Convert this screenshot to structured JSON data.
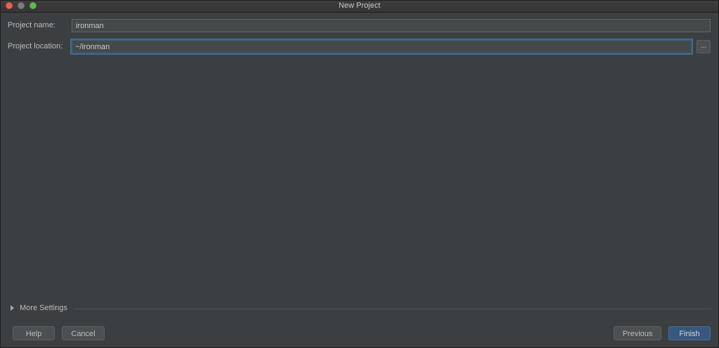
{
  "window": {
    "title": "New Project"
  },
  "form": {
    "project_name_label": "Project name:",
    "project_name_value": "ironman",
    "project_location_label": "Project location:",
    "project_location_value": "~/ironman",
    "browse_label": "..."
  },
  "more_settings": {
    "label": "More Settings",
    "expanded": false
  },
  "buttons": {
    "help": "Help",
    "cancel": "Cancel",
    "previous": "Previous",
    "finish": "Finish"
  },
  "colors": {
    "background": "#3c3f41",
    "field_background": "#45494a",
    "focus_border": "#3d6185",
    "default_button": "#365880",
    "close": "#ec5f57",
    "minimize": "#7c7c7c",
    "zoom": "#5bbd4a"
  }
}
